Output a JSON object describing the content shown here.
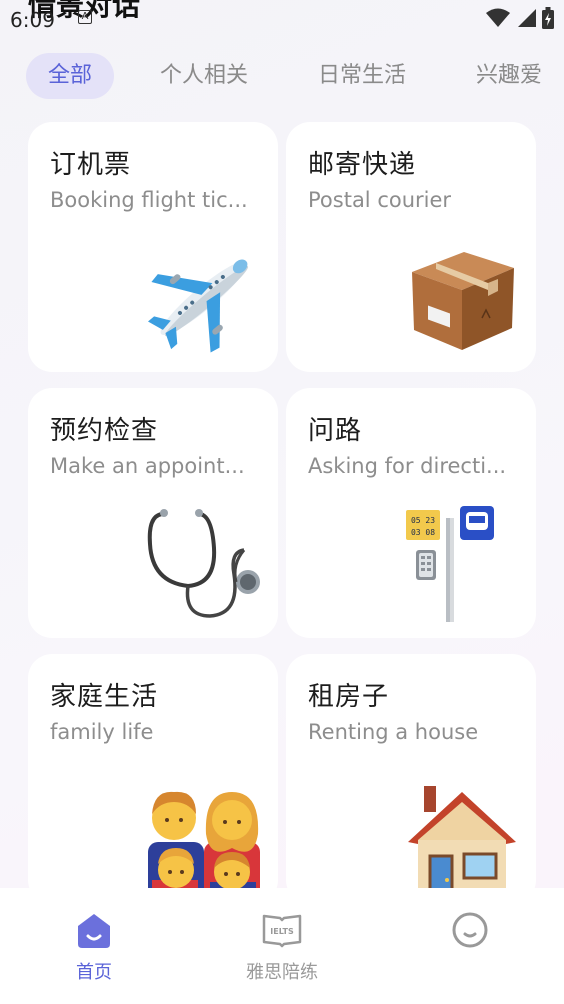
{
  "status_bar": {
    "time": "6:09",
    "a_badge": "A"
  },
  "page": {
    "title": "情景对话"
  },
  "tabs": [
    {
      "label": "全部",
      "active": true
    },
    {
      "label": "个人相关",
      "active": false
    },
    {
      "label": "日常生活",
      "active": false
    },
    {
      "label": "兴趣爱",
      "active": false
    }
  ],
  "cards": [
    {
      "title": "订机票",
      "subtitle": "Booking flight tic...",
      "icon": "airplane-icon"
    },
    {
      "title": "邮寄快递",
      "subtitle": "Postal courier",
      "icon": "package-icon"
    },
    {
      "title": "预约检查",
      "subtitle": "Make an appoint...",
      "icon": "stethoscope-icon"
    },
    {
      "title": "问路",
      "subtitle": "Asking for directi...",
      "icon": "bus-stop-icon"
    },
    {
      "title": "家庭生活",
      "subtitle": "family life",
      "icon": "family-icon"
    },
    {
      "title": "租房子",
      "subtitle": "Renting a house",
      "icon": "house-icon"
    }
  ],
  "bottom_nav": [
    {
      "label": "首页",
      "icon": "home-icon",
      "active": true
    },
    {
      "label": "雅思陪练",
      "icon": "ielts-icon",
      "active": false
    },
    {
      "label": "",
      "icon": "profile-icon",
      "active": false
    }
  ],
  "ielts_icon_text": "IELTS",
  "bus_stop_sign": {
    "line1": "05 23",
    "line2": "03 08"
  },
  "colors": {
    "accent": "#5a63d8",
    "tab_active_bg": "#e4e2f8",
    "card_bg": "#ffffff"
  }
}
